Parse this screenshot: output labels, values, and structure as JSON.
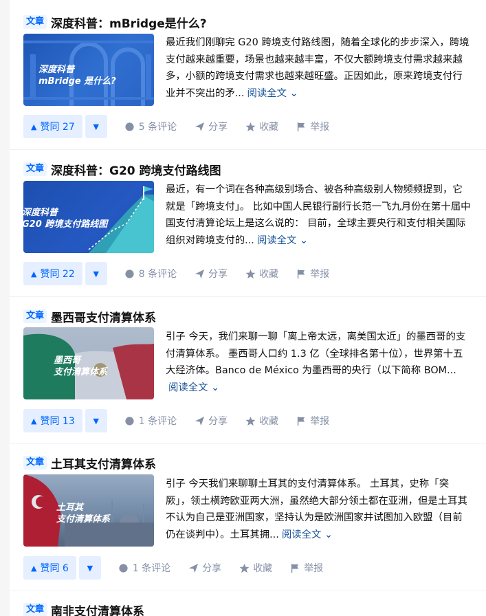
{
  "articles": [
    {
      "tag": "文章",
      "title": "深度科普：mBridge是什么?",
      "thumb_lines": [
        "深度科普",
        "mBridge 是什么?"
      ],
      "excerpt": "最近我们刚聊完 G20 跨境支付路线图，随着全球化的步步深入，跨境支付越来越重要，场景也越来越丰富，不仅大额跨境支付需求越来越多，小额的跨境支付需求也越来越旺盛。正因如此，原来跨境支付行业并不突出的矛...",
      "read_more": "阅读全文",
      "vote_label": "赞同 27",
      "comments": "5 条评论",
      "share": "分享",
      "favorite": "收藏",
      "report": "举报"
    },
    {
      "tag": "文章",
      "title": "深度科普：G20 跨境支付路线图",
      "thumb_lines": [
        "深度科普",
        "G20 跨境支付路线图"
      ],
      "excerpt": "最近，有一个词在各种高级别场合、被各种高级别人物频频提到，它就是「跨境支付」。 比如中国人民银行副行长范一飞九月份在第十届中国支付清算论坛上是这么说的： 目前，全球主要央行和支付相关国际组织对跨境支付的...",
      "read_more": "阅读全文",
      "vote_label": "赞同 22",
      "comments": "8 条评论",
      "share": "分享",
      "favorite": "收藏",
      "report": "举报"
    },
    {
      "tag": "文章",
      "title": "墨西哥支付清算体系",
      "thumb_lines": [
        "墨西哥",
        "支付清算体系"
      ],
      "excerpt": "引子 今天，我们来聊一聊「离上帝太远，离美国太近」的墨西哥的支付清算体系。 墨西哥人口约 1.3 亿（全球排名第十位），世界第十五大经济体。Banco de México 为墨西哥的央行（以下简称 BOM...",
      "read_more": "阅读全文",
      "vote_label": "赞同 13",
      "comments": "1 条评论",
      "share": "分享",
      "favorite": "收藏",
      "report": "举报"
    },
    {
      "tag": "文章",
      "title": "土耳其支付清算体系",
      "thumb_lines": [
        "土耳其",
        "支付清算体系"
      ],
      "excerpt": "引子 今天我们来聊聊土耳其的支付清算体系。 土耳其，史称「突厥」，领土横跨欧亚两大洲，虽然绝大部分领土都在亚洲，但是土耳其不认为自己是亚洲国家，坚持认为是欧洲国家并试图加入欧盟（目前仍在谈判中）。土耳其拥...",
      "read_more": "阅读全文",
      "vote_label": "赞同 6",
      "comments": "1 条评论",
      "share": "分享",
      "favorite": "收藏",
      "report": "举报"
    },
    {
      "tag": "文章",
      "title": "南非支付清算体系"
    }
  ],
  "colors": {
    "accent": "#0066ff",
    "accent_bg": "#e5efff",
    "meta_gray": "#8590a6",
    "link": "#175199"
  }
}
